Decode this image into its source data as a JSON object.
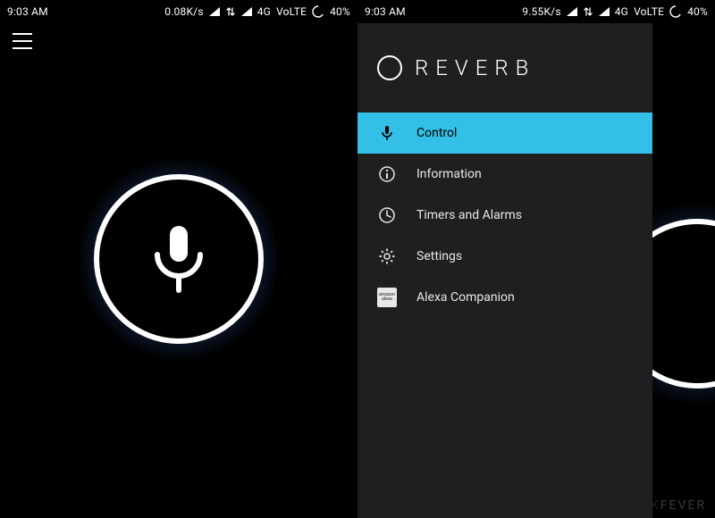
{
  "status": {
    "time": "9:03 AM",
    "network": "4G",
    "volte": "VoLTE",
    "battery": "40%"
  },
  "left": {
    "speed": "0.08K/s"
  },
  "right": {
    "speed": "9.55K/s",
    "app_title": "REVERB",
    "menu": [
      {
        "label": "Control",
        "active": true
      },
      {
        "label": "Information",
        "active": false
      },
      {
        "label": "Timers and Alarms",
        "active": false
      },
      {
        "label": "Settings",
        "active": false
      },
      {
        "label": "Alexa Companion",
        "active": false
      }
    ],
    "watermark_a": "QUICK",
    "watermark_b": "FEVER"
  },
  "colors": {
    "accent": "#34c0e6",
    "glow": "#4682ff",
    "drawer": "#1f1f1f"
  }
}
